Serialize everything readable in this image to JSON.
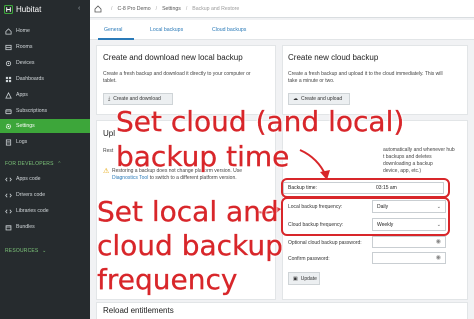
{
  "sidebar": {
    "brand": "Hubitat",
    "items": [
      {
        "label": "Home",
        "icon": "home-icon"
      },
      {
        "label": "Rooms",
        "icon": "rooms-icon"
      },
      {
        "label": "Devices",
        "icon": "devices-icon"
      },
      {
        "label": "Dashboards",
        "icon": "dashboards-icon"
      },
      {
        "label": "Apps",
        "icon": "apps-icon"
      },
      {
        "label": "Subscriptions",
        "icon": "subscriptions-icon"
      },
      {
        "label": "Settings",
        "icon": "gear-icon",
        "active": true
      },
      {
        "label": "Logs",
        "icon": "logs-icon"
      }
    ],
    "developers_label": "FOR DEVELOPERS",
    "dev_items": [
      {
        "label": "Apps code"
      },
      {
        "label": "Drivers code"
      },
      {
        "label": "Libraries code"
      },
      {
        "label": "Bundles"
      }
    ],
    "resources_label": "RESOURCES"
  },
  "breadcrumb": {
    "hub": "C-8 Pro Demo",
    "section": "Settings",
    "page": "Backup and Restore"
  },
  "tabs": [
    "General",
    "Local backups",
    "Cloud backups"
  ],
  "local_card": {
    "title": "Create and download new local backup",
    "desc_1": "Create a fresh backup and download it directly to your computer or",
    "desc_2": "tablet.",
    "button": "Create and download"
  },
  "cloud_card": {
    "title": "Create new cloud backup",
    "desc_1": "Create a fresh backup and upload it to the cloud immediately. This will",
    "desc_2": "take a minute or two.",
    "button": "Create and upload"
  },
  "upload_card": {
    "title": "Upl",
    "rest": "Rest",
    "notice_1": "Restoring a backup does not change platform version. Use",
    "notice_2_link": "Diagnostics Tool",
    "notice_2": " to switch to a different platform version."
  },
  "settings_card": {
    "text_1": "automatically and whenever hub",
    "text_2": "t backups and deletes",
    "text_3": "downloading a backup",
    "text_4": "device, app, etc.)",
    "backup_time_label": "Backup time:",
    "backup_time_value": "03:15 am",
    "local_freq_label": "Local backup frequency:",
    "local_freq_value": "Daily",
    "cloud_freq_label": "Cloud backup frequency:",
    "cloud_freq_value": "Weekly",
    "password_label": "Optional cloud backup password:",
    "confirm_label": "Confirm password:",
    "update_button": "Update"
  },
  "reload": {
    "title": "Reload entitlements"
  },
  "annotations": {
    "line_1": "Set cloud (and local)",
    "line_2": "backup time",
    "line_3": "Set local and",
    "line_4": "cloud backup",
    "line_5": "frequency",
    "color": "#d8262a"
  },
  "colors": {
    "sidebar_bg": "#262b2e",
    "active": "#3da63a",
    "accent": "#2a7ab8"
  }
}
